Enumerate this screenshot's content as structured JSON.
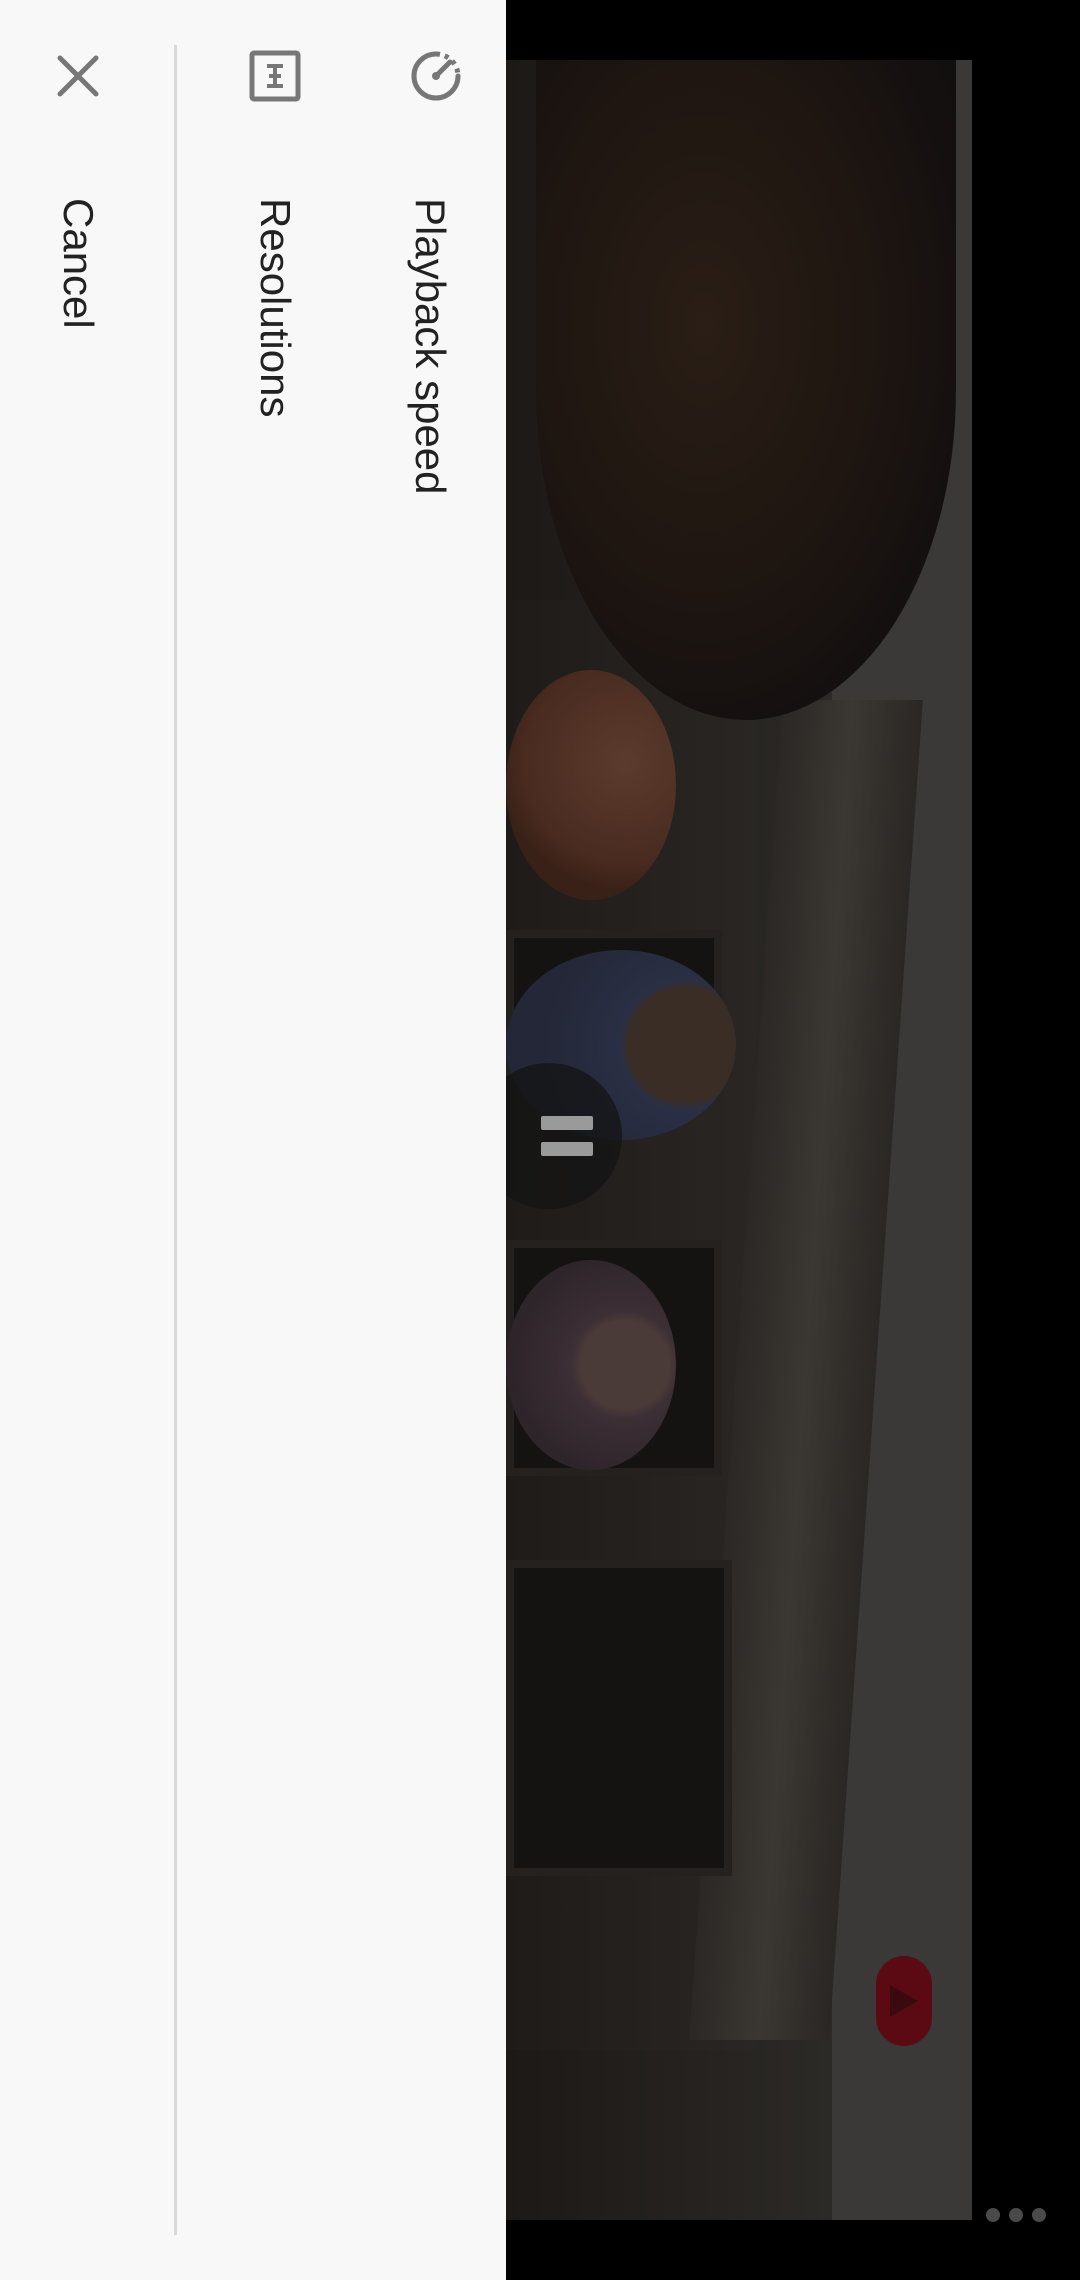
{
  "options_sheet": {
    "items": [
      {
        "label": "Playback speed",
        "icon": "playback-speed-icon"
      },
      {
        "label": "Resolutions",
        "icon": "resolution-icon"
      },
      {
        "label": "Cancel",
        "icon": "close-icon"
      }
    ]
  },
  "player": {
    "state": "paused",
    "center_control_icon": "pause-icon",
    "seek_thumb_color": "#5b0a14",
    "more_icon": "more-horizontal-icon"
  },
  "colors": {
    "sheet_background": "#f8f8f8",
    "label_text": "#222222",
    "icon_gray": "#777777",
    "divider": "#d9d9d9"
  }
}
